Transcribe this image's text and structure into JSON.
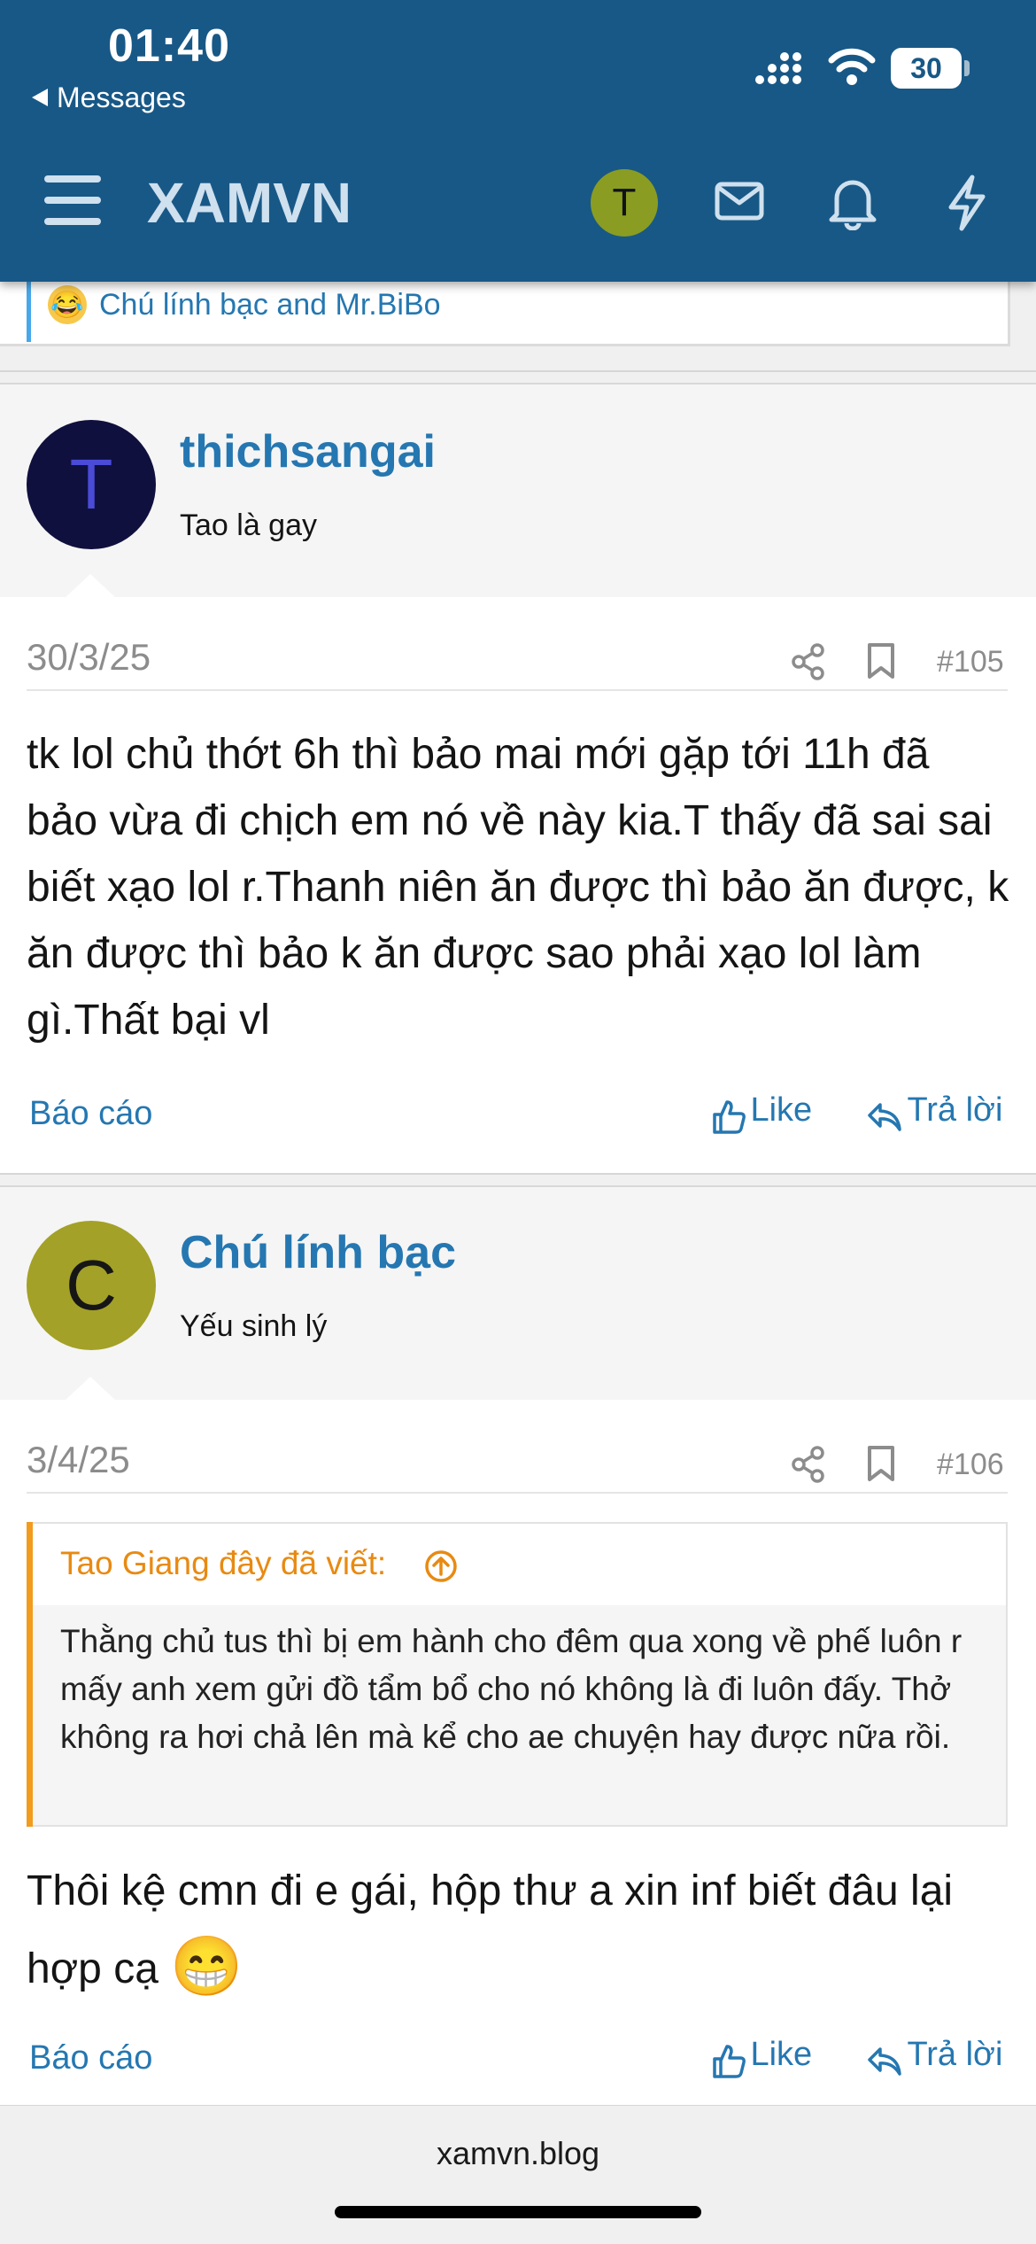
{
  "status_bar": {
    "time": "01:40",
    "back_label": "Messages",
    "battery": "30"
  },
  "header": {
    "logo": "XAMVN",
    "avatar_letter": "T"
  },
  "reactions": {
    "text": "Chú lính bạc and Mr.BiBo",
    "emoji": "😂"
  },
  "posts": [
    {
      "avatar_letter": "T",
      "avatar_color": "#10103e",
      "avatar_text_color": "#4a4bd6",
      "username": "thichsangai",
      "user_title": "Tao là gay",
      "date": "30/3/25",
      "number": "#105",
      "text": "tk lol chủ thớt 6h thì bảo mai mới gặp tới 11h đã bảo vừa đi chịch em nó về này kia.T thấy đã sai sai biết xạo lol r.Thanh niên ăn được thì bảo ăn được, k ăn được thì bảo k ăn được sao phải xạo lol làm gì.Thất bại vl",
      "report": "Báo cáo",
      "like": "Like",
      "reply": "Trả lời"
    },
    {
      "avatar_letter": "C",
      "avatar_color": "#a3a127",
      "avatar_text_color": "#161616",
      "username": "Chú lính bạc",
      "user_title": "Yếu sinh lý",
      "date": "3/4/25",
      "number": "#106",
      "quote_header": "Tao Giang đây đã viết:",
      "quote_text": "Thằng chủ tus thì bị em hành cho đêm qua xong về phế luôn r mấy anh xem gửi đồ tẩm bổ cho nó không là đi luôn đấy. Thở không ra hơi chả lên mà kể cho ae chuyện hay được nữa rồi.",
      "text": "Thôi kệ cmn đi e gái, hộp thư a xin inf biết đâu lại hợp cạ",
      "emoji": "😁",
      "report": "Báo cáo",
      "like": "Like",
      "reply": "Trả lời"
    }
  ],
  "footer": {
    "url": "xamvn.blog"
  },
  "colors": {
    "header_bg": "#185886",
    "link": "#2577b1",
    "quote_accent": "#f29b1c"
  }
}
